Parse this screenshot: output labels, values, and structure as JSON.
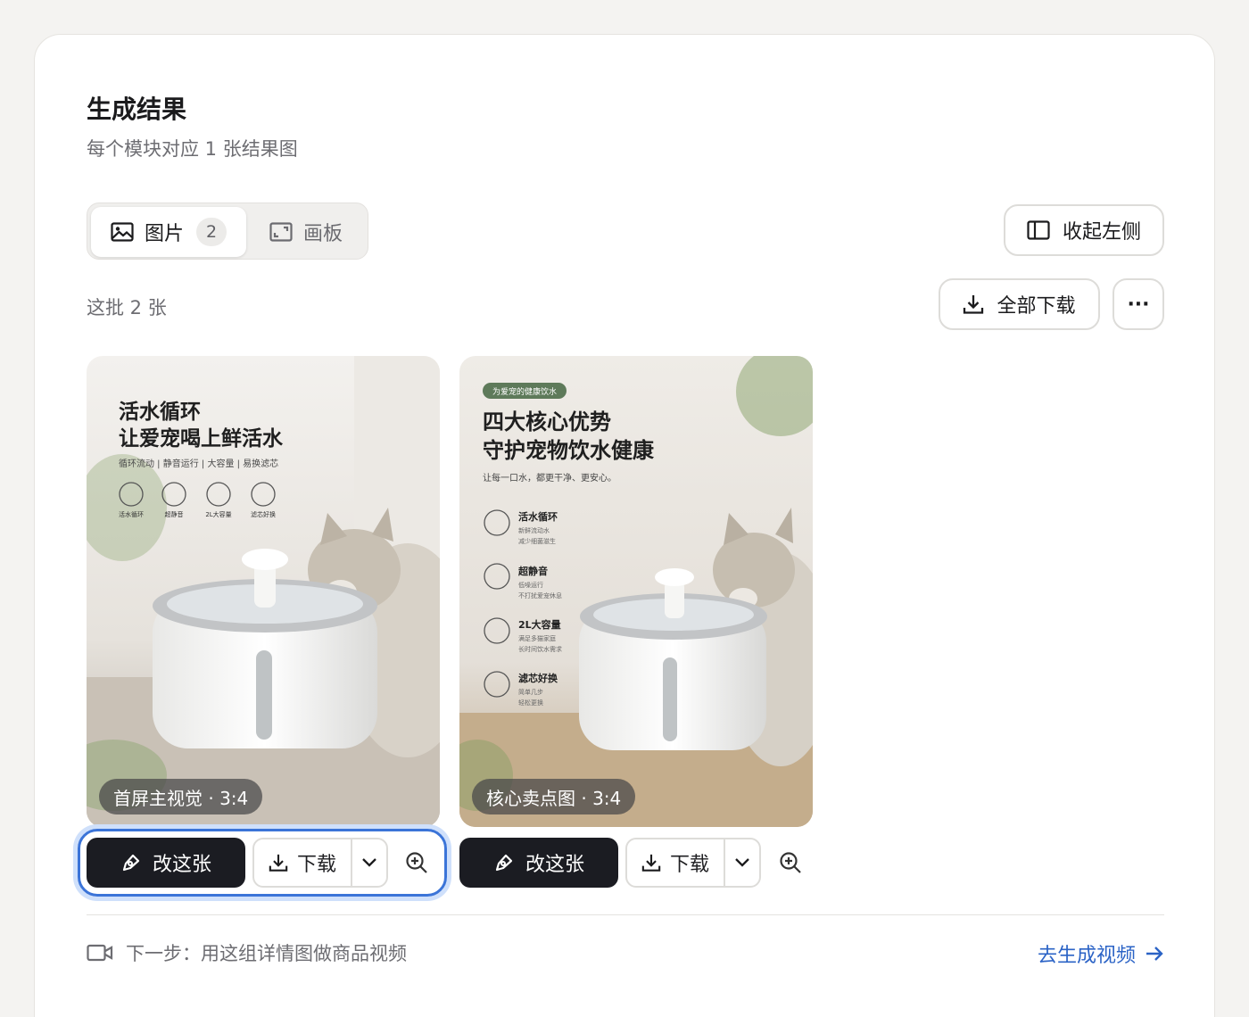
{
  "header": {
    "title": "生成结果",
    "subtitle": "每个模块对应 1 张结果图"
  },
  "tabs": [
    {
      "label": "图片",
      "badge": "2",
      "icon": "image-icon",
      "active": true
    },
    {
      "label": "画板",
      "icon": "artboard-icon",
      "active": false
    }
  ],
  "toolbar": {
    "collapse_label": "收起左侧",
    "batch_count": "这批 2 张",
    "download_all_label": "全部下载",
    "more_label": "···"
  },
  "cards": [
    {
      "caption": "首屏主视觉 · 3:4",
      "art": {
        "headline1": "活水循环",
        "headline2": "让爱宠喝上鲜活水",
        "tagline": "循环流动 | 静音运行 | 大容量 | 易换滤芯",
        "features": [
          "活水循环",
          "超静音",
          "2L大容量",
          "滤芯好换"
        ]
      },
      "edit_label": "改这张",
      "download_label": "下载",
      "focused": true
    },
    {
      "caption": "核心卖点图 · 3:4",
      "art": {
        "pill": "为爱宠的健康饮水",
        "headline1": "四大核心优势",
        "headline2": "守护宠物饮水健康",
        "tagline": "让每一口水，都更干净、更安心。",
        "features": [
          {
            "name": "活水循环",
            "desc1": "新鲜流动水",
            "desc2": "减少细菌滋生"
          },
          {
            "name": "超静音",
            "desc1": "低噪运行",
            "desc2": "不打扰爱宠休息"
          },
          {
            "name": "2L大容量",
            "desc1": "满足多猫家庭",
            "desc2": "长时间饮水需求"
          },
          {
            "name": "滤芯好换",
            "desc1": "简单几步",
            "desc2": "轻松更换"
          }
        ]
      },
      "edit_label": "改这张",
      "download_label": "下载",
      "focused": false
    }
  ],
  "footer": {
    "next_step": "下一步：用这组详情图做商品视频",
    "go_label": "去生成视频"
  },
  "colors": {
    "accent_blue": "#2b63c6",
    "focus_ring": "#3b74d8",
    "dark_button": "#1b1c22"
  }
}
